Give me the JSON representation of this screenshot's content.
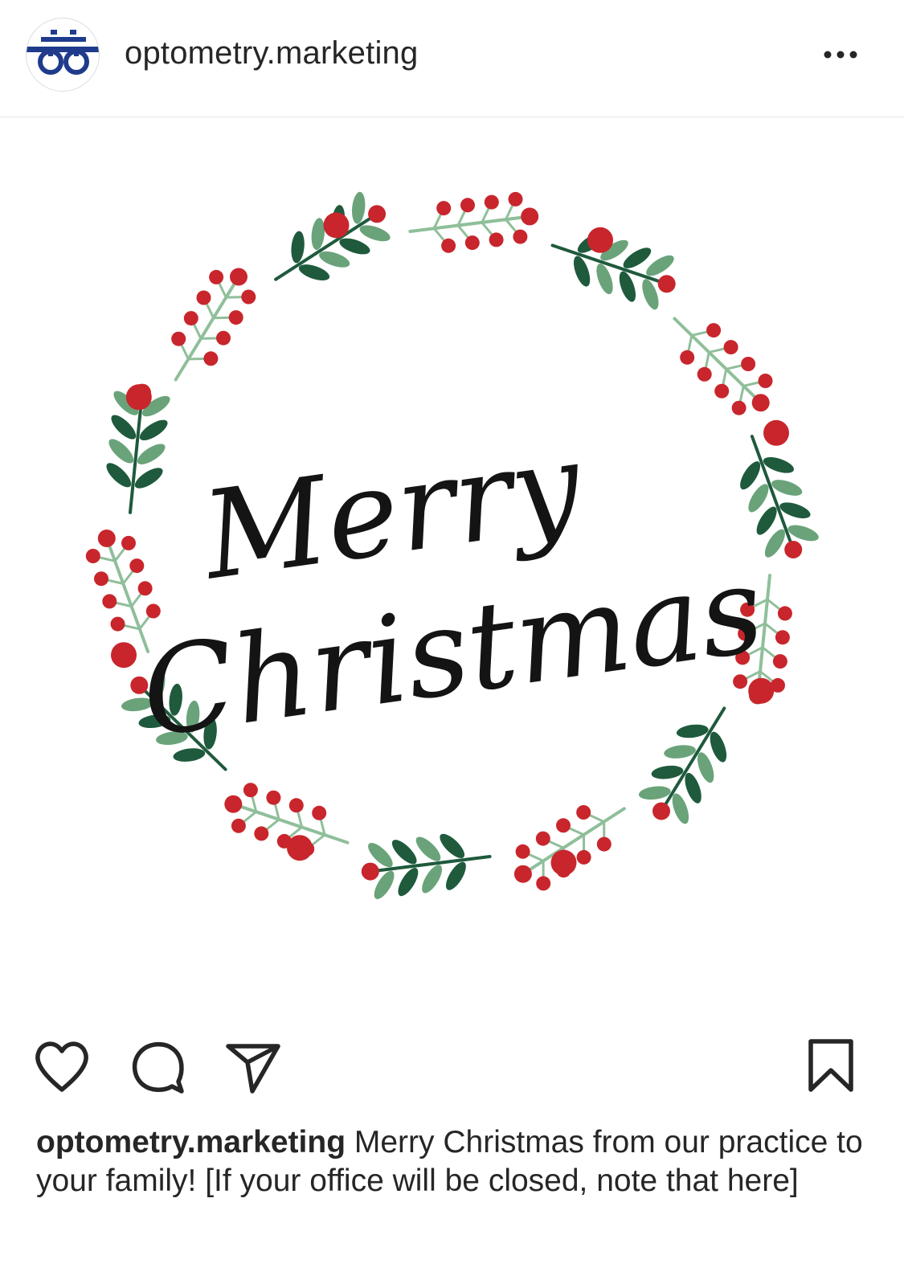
{
  "header": {
    "username": "optometry.marketing",
    "avatar_icon": "eyeglasses-logo-icon",
    "more_icon": "more-options-icon"
  },
  "post": {
    "image_text": {
      "line1": "Merry",
      "line2": "Christmas"
    },
    "colors": {
      "berry": "#c8262c",
      "leaf_dark": "#1f5a3d",
      "leaf_light": "#6aa37a",
      "stem": "#8fbf9a"
    }
  },
  "actions": {
    "like_icon": "heart-icon",
    "comment_icon": "comment-icon",
    "share_icon": "share-icon",
    "save_icon": "bookmark-icon"
  },
  "caption": {
    "username": "optometry.marketing",
    "text": "Merry Christmas from our practice to your family! [If your office will be closed, note that here]"
  }
}
